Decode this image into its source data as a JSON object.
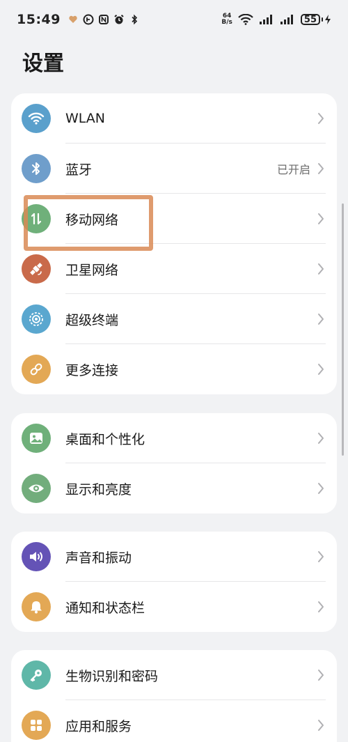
{
  "status_bar": {
    "time": "15:49",
    "net_speed_value": "64",
    "net_speed_unit": "B/s",
    "battery": "55"
  },
  "page": {
    "title": "设置"
  },
  "groups": [
    {
      "items": [
        {
          "label": "WLAN",
          "value": "",
          "icon": "wifi-icon",
          "color": "#5aa0cc"
        },
        {
          "label": "蓝牙",
          "value": "已开启",
          "icon": "bluetooth-icon",
          "color": "#6f9ecb"
        },
        {
          "label": "移动网络",
          "value": "",
          "icon": "mobile-data-icon",
          "color": "#6fb07a"
        },
        {
          "label": "卫星网络",
          "value": "",
          "icon": "satellite-icon",
          "color": "#c96a4a"
        },
        {
          "label": "超级终端",
          "value": "",
          "icon": "super-device-icon",
          "color": "#5aa7cf"
        },
        {
          "label": "更多连接",
          "value": "",
          "icon": "link-icon",
          "color": "#e3a855"
        }
      ]
    },
    {
      "items": [
        {
          "label": "桌面和个性化",
          "value": "",
          "icon": "wallpaper-icon",
          "color": "#6fb07a"
        },
        {
          "label": "显示和亮度",
          "value": "",
          "icon": "eye-icon",
          "color": "#72ad7c"
        }
      ]
    },
    {
      "items": [
        {
          "label": "声音和振动",
          "value": "",
          "icon": "volume-icon",
          "color": "#6453b6"
        },
        {
          "label": "通知和状态栏",
          "value": "",
          "icon": "bell-icon",
          "color": "#e3a855"
        }
      ]
    },
    {
      "items": [
        {
          "label": "生物识别和密码",
          "value": "",
          "icon": "key-icon",
          "color": "#5fb7a8"
        },
        {
          "label": "应用和服务",
          "value": "",
          "icon": "apps-icon",
          "color": "#e3a855"
        }
      ]
    }
  ],
  "colors": {
    "background": "#f1f2f4",
    "card": "#ffffff",
    "highlight": "#d98a55"
  }
}
